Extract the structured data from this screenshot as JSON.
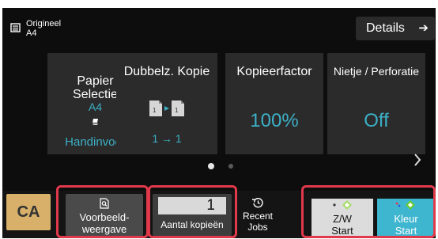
{
  "header": {
    "original_label": "Origineel",
    "original_size": "A4",
    "details_label": "Details",
    "details_arrow": "➔"
  },
  "tiles": [
    {
      "title_line1": "Papier",
      "title_line2": "Selectie",
      "size": "A4",
      "tray": "Handinvoer"
    },
    {
      "title": "Dubbelz. Kopie",
      "value": "1 → 1"
    },
    {
      "title": "Kopieerfactor",
      "value": "100%"
    },
    {
      "title": "Nietje / Perforatie",
      "value": "Off"
    }
  ],
  "pager": {
    "pages": 2,
    "current": 1
  },
  "bottom": {
    "ca_label": "CA",
    "preview_line1": "Voorbeeld-",
    "preview_line2": "weergave",
    "copies_value": "1",
    "copies_label": "Aantal kopieën",
    "recent_line1": "Recent",
    "recent_line2": "Jobs",
    "bw_start_line1": "Z/W",
    "bw_start_line2": "Start",
    "color_start_line1": "Kleur",
    "color_start_line2": "Start"
  },
  "colors": {
    "accent": "#3cb0c6",
    "tile_bg": "#2b2b2b",
    "highlight_border": "#e0394b",
    "ca_button": "#d8b06a",
    "color_start": "#3fb6cf",
    "start_icon_green": "#66cc33"
  },
  "icons": [
    "document-icon",
    "arrow-right-icon",
    "paper-tray-icon",
    "duplex-icon",
    "preview-icon",
    "history-icon",
    "start-diamond-icon",
    "chevron-right-icon"
  ]
}
